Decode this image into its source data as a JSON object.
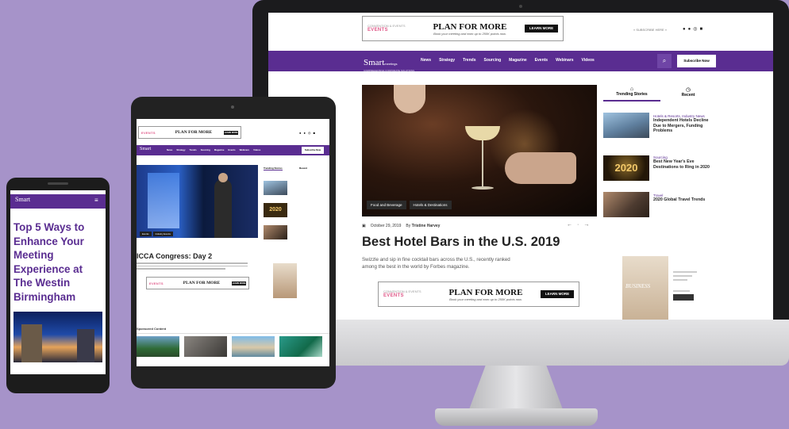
{
  "brand": {
    "name": "Smart",
    "purple": "#5a2d91",
    "background": "#a693c9"
  },
  "ad_banner": {
    "logo": "EVENTS",
    "headline": "PLAN FOR MORE",
    "subline": "Book your meeting and earn up to 250K points now.",
    "cta": "LEARN MORE"
  },
  "desktop": {
    "header_link": "« SUBSCRIBE HERE »",
    "nav": [
      "News",
      "Strategy",
      "Trends",
      "Sourcing",
      "Magazine",
      "Events",
      "Webinars",
      "Videos"
    ],
    "subscribe": "Subscribe Now",
    "tabs": [
      "Trending Stories",
      "Recent"
    ],
    "hero_tags": [
      "Food and Beverage",
      "Hotels & Destinations"
    ],
    "article": {
      "date": "October 29, 2019",
      "author_prefix": "By",
      "author": "Tristine Harvey",
      "title": "Best Hotel Bars in the U.S. 2019",
      "excerpt_line1": "Swizzle and sip in fine cocktail bars across the U.S., recently ranked",
      "excerpt_line2": "among the best in the world by Forbes magazine."
    },
    "sidebar": [
      {
        "category": "Hotels & Resorts, Industry News",
        "title": "Independent Hotels Decline Due to Mergers, Funding Problems"
      },
      {
        "category": "Sourcing",
        "title": "Best New Year's Eve Destinations to Ring in 2020",
        "img_text": "2020"
      },
      {
        "category": "Travel",
        "title": "2020 Global Travel Trends"
      }
    ],
    "magazine_text": "BUSINESS"
  },
  "tablet": {
    "nav": [
      "News",
      "Strategy",
      "Trends",
      "Sourcing",
      "Magazine",
      "Events",
      "Webinars",
      "Videos"
    ],
    "subscribe": "Subscribe Now",
    "tabs": [
      "Trending Stories",
      "Recent"
    ],
    "hero_tags": [
      "Events",
      "Industry Events"
    ],
    "article": {
      "title": "ICCA Congress: Day 2"
    },
    "sidebar_img_text": "2020",
    "section_title": "Sponsored Content"
  },
  "phone": {
    "headline": "Top 5 Ways to Enhance Your Meeting Experience at The Westin Birmingham"
  }
}
